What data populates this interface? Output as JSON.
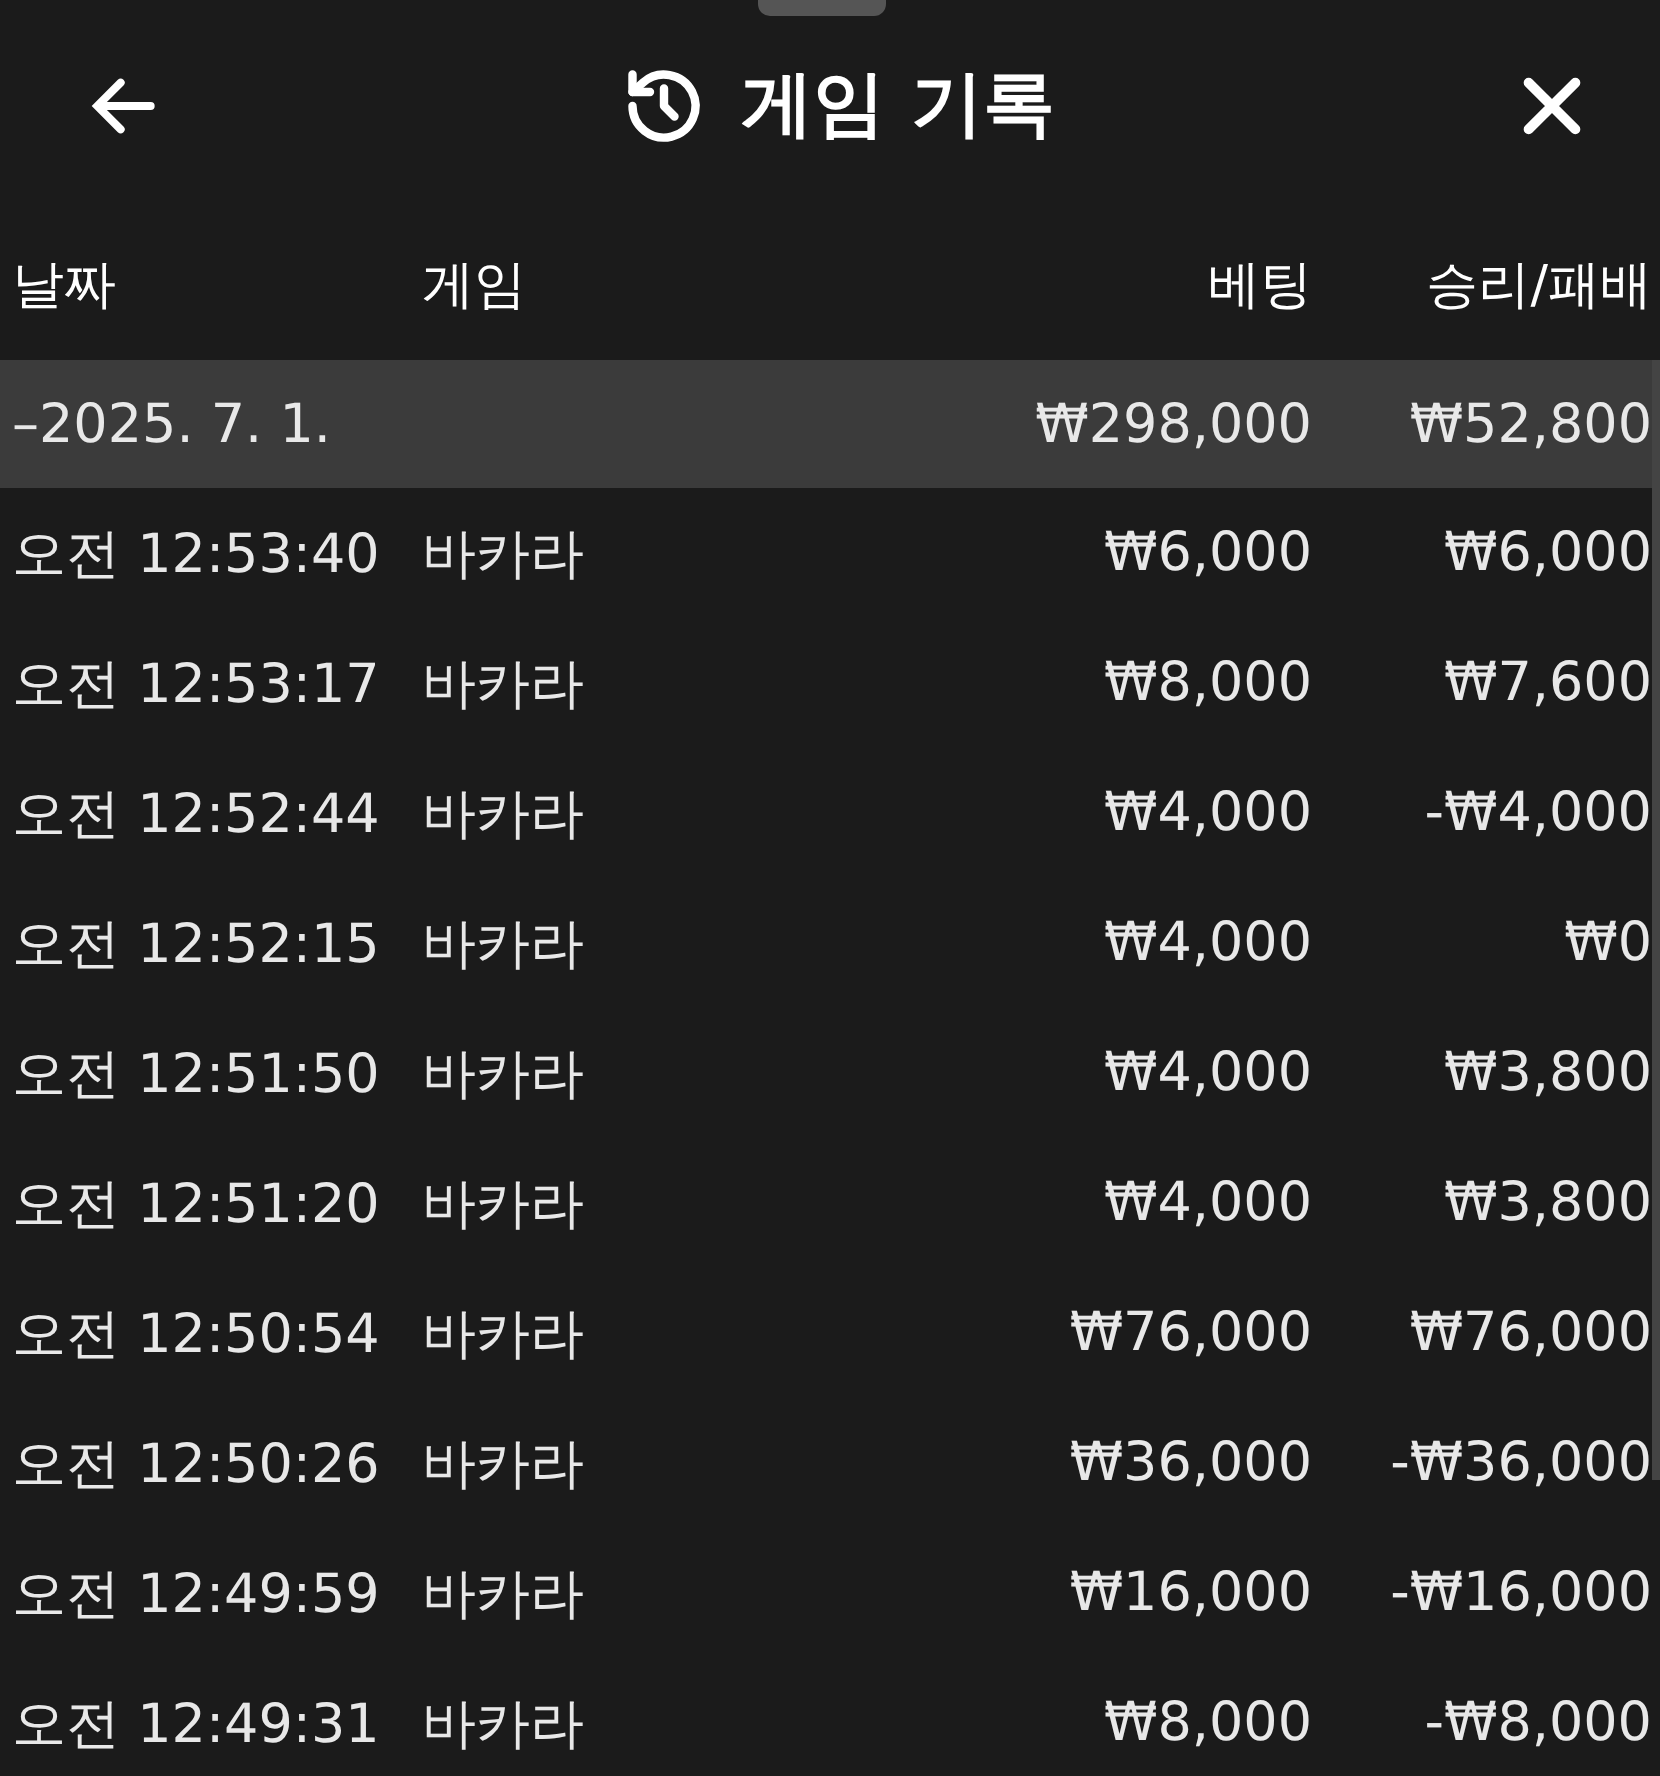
{
  "header": {
    "title": "게임 기록"
  },
  "table": {
    "columns": [
      "날짜",
      "게임",
      "베팅",
      "승리/패배"
    ],
    "group": {
      "date": "–2025. 7. 1.",
      "bet": "₩298,000",
      "result": "₩52,800"
    },
    "rows": [
      {
        "time": "오전 12:53:40",
        "game": "바카라",
        "bet": "₩6,000",
        "result": "₩6,000"
      },
      {
        "time": "오전 12:53:17",
        "game": "바카라",
        "bet": "₩8,000",
        "result": "₩7,600"
      },
      {
        "time": "오전 12:52:44",
        "game": "바카라",
        "bet": "₩4,000",
        "result": "-₩4,000"
      },
      {
        "time": "오전 12:52:15",
        "game": "바카라",
        "bet": "₩4,000",
        "result": "₩0"
      },
      {
        "time": "오전 12:51:50",
        "game": "바카라",
        "bet": "₩4,000",
        "result": "₩3,800"
      },
      {
        "time": "오전 12:51:20",
        "game": "바카라",
        "bet": "₩4,000",
        "result": "₩3,800"
      },
      {
        "time": "오전 12:50:54",
        "game": "바카라",
        "bet": "₩76,000",
        "result": "₩76,000"
      },
      {
        "time": "오전 12:50:26",
        "game": "바카라",
        "bet": "₩36,000",
        "result": "-₩36,000"
      },
      {
        "time": "오전 12:49:59",
        "game": "바카라",
        "bet": "₩16,000",
        "result": "-₩16,000"
      },
      {
        "time": "오전 12:49:31",
        "game": "바카라",
        "bet": "₩8,000",
        "result": "-₩8,000"
      }
    ]
  }
}
